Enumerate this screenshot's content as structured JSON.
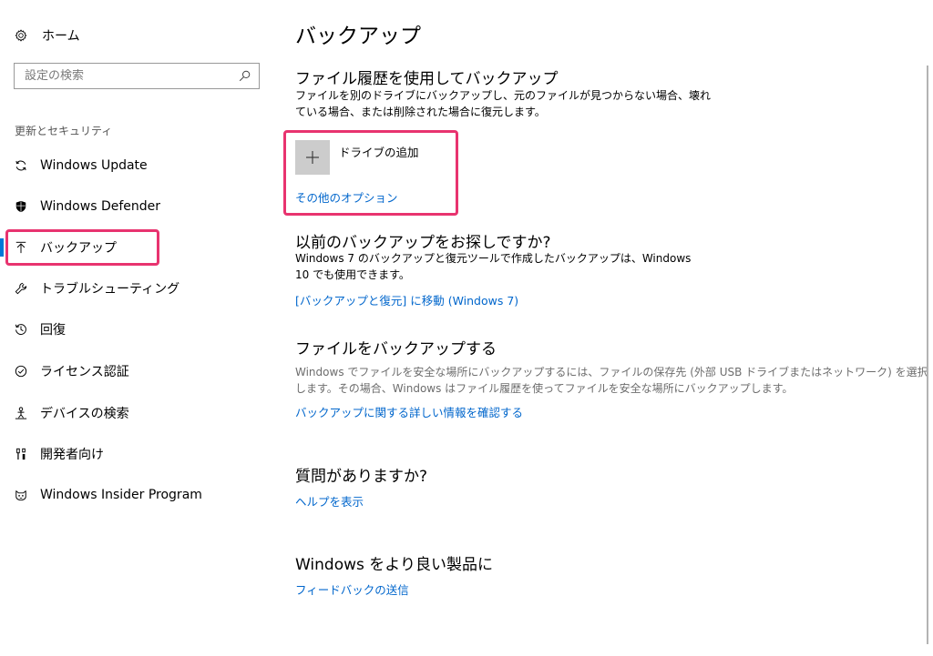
{
  "sidebar": {
    "home_label": "ホーム",
    "search_placeholder": "設定の検索",
    "group_label": "更新とセキュリティ",
    "items": [
      {
        "label": "Windows Update",
        "icon": "refresh-icon"
      },
      {
        "label": "Windows Defender",
        "icon": "shield-icon"
      },
      {
        "label": "バックアップ",
        "icon": "backup-arrow-icon",
        "selected": true
      },
      {
        "label": "トラブルシューティング",
        "icon": "wrench-icon"
      },
      {
        "label": "回復",
        "icon": "history-icon"
      },
      {
        "label": "ライセンス認証",
        "icon": "check-circle-icon"
      },
      {
        "label": "デバイスの検索",
        "icon": "person-location-icon"
      },
      {
        "label": "開発者向け",
        "icon": "developer-tools-icon"
      },
      {
        "label": "Windows Insider Program",
        "icon": "insider-cat-icon"
      }
    ]
  },
  "main": {
    "page_title": "バックアップ",
    "file_history": {
      "title": "ファイル履歴を使用してバックアップ",
      "desc_line1": "ファイルを別のドライブにバックアップし、元のファイルが見つからない場合、壊れ",
      "desc_line2": "ている場合、または削除された場合に復元します。",
      "add_drive_label": "ドライブの追加",
      "more_options_link": "その他のオプション"
    },
    "older_backup": {
      "title": "以前のバックアップをお探しですか?",
      "desc_line1": "Windows 7 のバックアップと復元ツールで作成したバックアップは、Windows",
      "desc_line2": "10 でも使用できます。",
      "link": "[バックアップと復元] に移動 (Windows 7)"
    },
    "backup_files": {
      "title": "ファイルをバックアップする",
      "desc_line1": "Windows でファイルを安全な場所にバックアップするには、ファイルの保存先 (外部 USB ドライブまたはネットワーク) を選択",
      "desc_line2": "します。その場合、Windows はファイル履歴を使ってファイルを安全な場所にバックアップします。",
      "link": "バックアップに関する詳しい情報を確認する"
    },
    "questions": {
      "title": "質問がありますか?",
      "link": "ヘルプを表示"
    },
    "feedback": {
      "title": "Windows をより良い製品に",
      "link": "フィードバックの送信"
    }
  },
  "colors": {
    "accent": "#0078d7",
    "link": "#0066cc",
    "annotation_highlight": "#e8336f",
    "tile_gray": "#cccccc"
  }
}
